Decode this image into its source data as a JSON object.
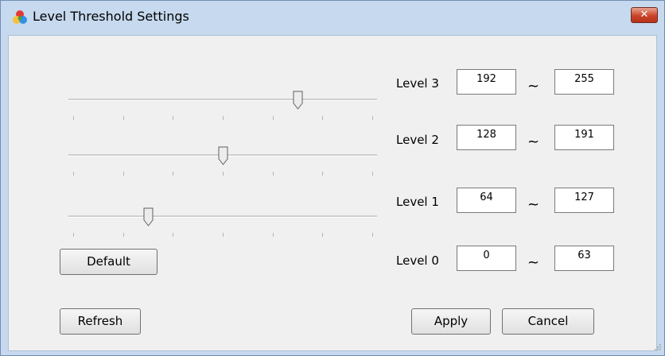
{
  "window": {
    "title": "Level Threshold Settings",
    "close_label": "✕"
  },
  "levels": [
    {
      "label": "Level 3",
      "min": "192",
      "max": "255",
      "separator": "~"
    },
    {
      "label": "Level 2",
      "min": "128",
      "max": "191",
      "separator": "~"
    },
    {
      "label": "Level 1",
      "min": "64",
      "max": "127",
      "separator": "~"
    },
    {
      "label": "Level 0",
      "min": "0",
      "max": "63",
      "separator": "~"
    }
  ],
  "sliders": [
    {
      "name": "level-3-slider",
      "value": 192,
      "min": 0,
      "max": 255
    },
    {
      "name": "level-2-slider",
      "value": 128,
      "min": 0,
      "max": 255
    },
    {
      "name": "level-1-slider",
      "value": 64,
      "min": 0,
      "max": 255
    }
  ],
  "buttons": {
    "default": "Default",
    "refresh": "Refresh",
    "apply": "Apply",
    "cancel": "Cancel"
  },
  "colors": {
    "titlebar": "#c6d9ee",
    "client": "#f0f0f0",
    "close": "#c9442a"
  },
  "icons": {
    "app": "rgb-circles-icon",
    "close": "close-icon",
    "thumb": "slider-thumb-icon",
    "grip": "resize-grip-icon"
  }
}
